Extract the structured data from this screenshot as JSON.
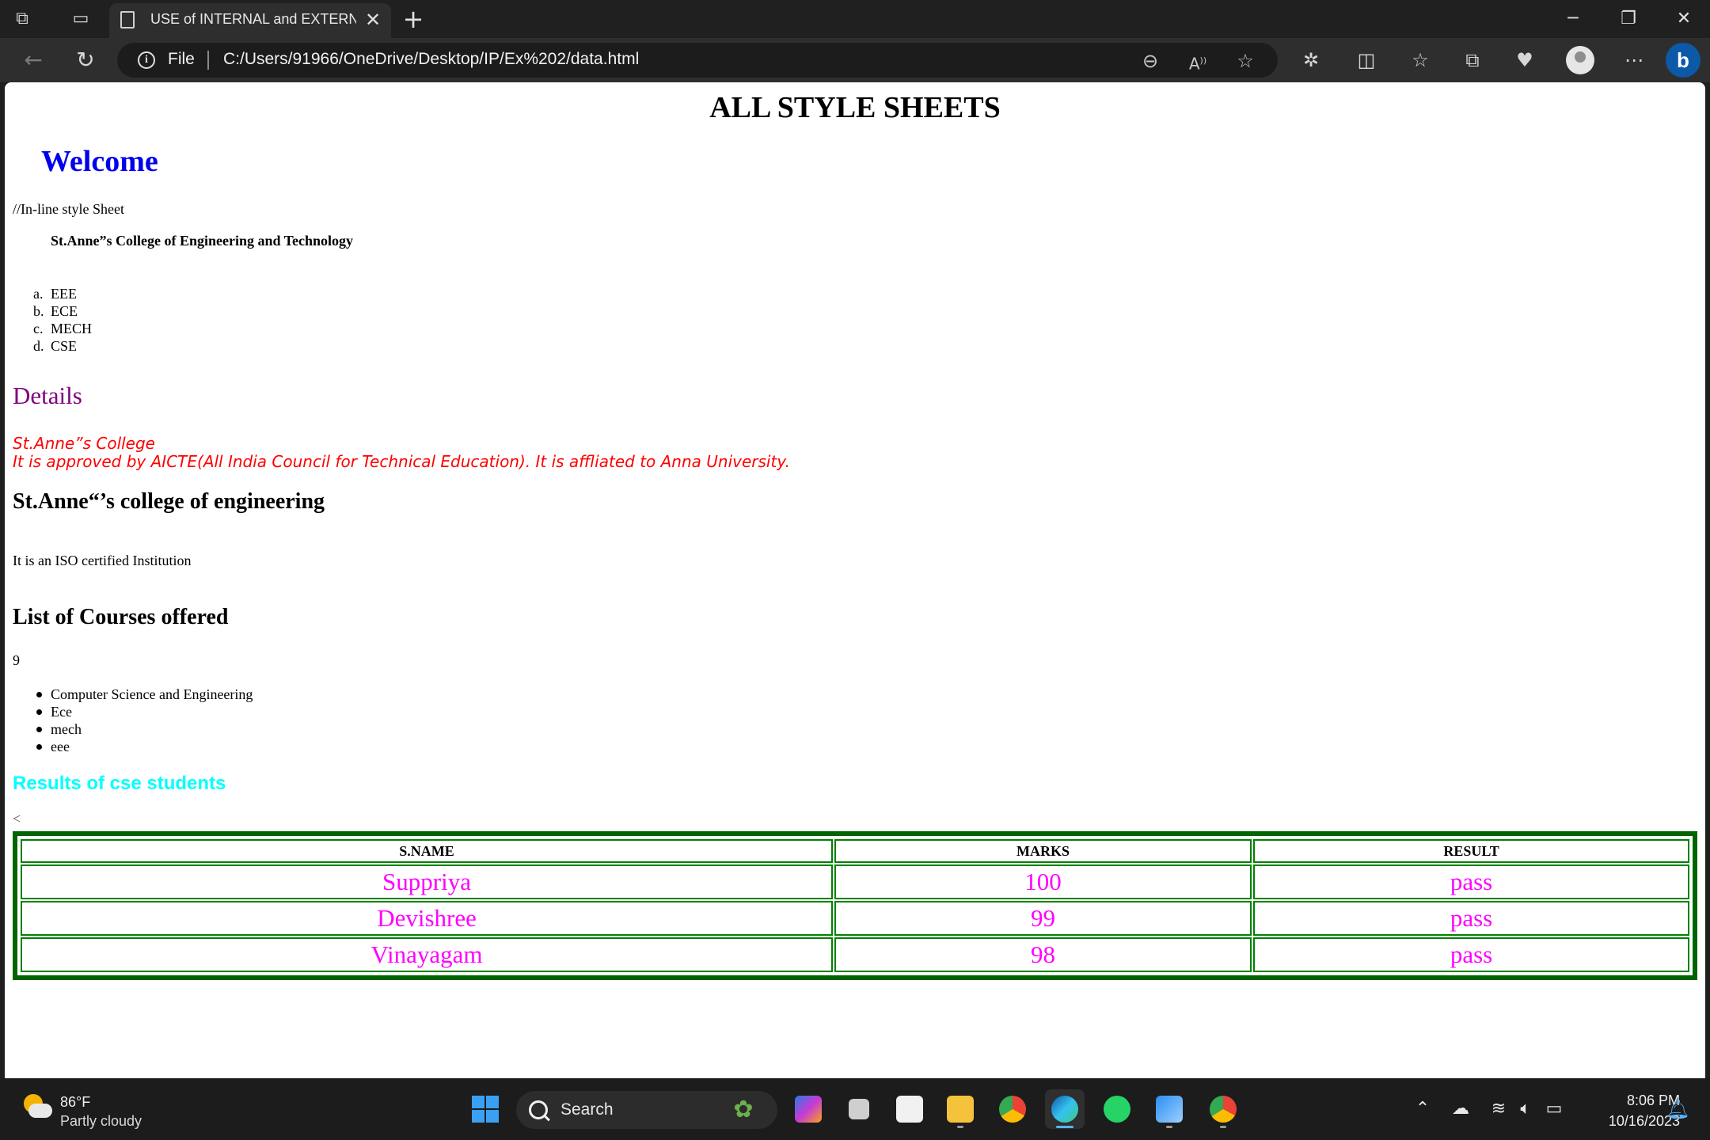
{
  "browser": {
    "tab_title": "USE of INTERNAL and EXTERNAL",
    "address_scheme_label": "File",
    "url": "C:/Users/91966/OneDrive/Desktop/IP/Ex%202/data.html"
  },
  "page": {
    "main_heading": "ALL STYLE SHEETS",
    "welcome": "Welcome",
    "inline_note": "//In-line style Sheet",
    "college_name": "St.Anne”s College of Engineering and Technology",
    "departments": [
      {
        "marker": "a.",
        "label": "EEE"
      },
      {
        "marker": "b.",
        "label": "ECE"
      },
      {
        "marker": "c.",
        "label": "MECH"
      },
      {
        "marker": "d.",
        "label": "CSE"
      }
    ],
    "details_heading": "Details",
    "details_line1": "St.Anne”s College",
    "details_line2": "It is approved by AICTE(All India Council for Technical Education). It is affliated to Anna University.",
    "sub_heading": "St.Anne“’s college of engineering",
    "iso_text": "It is an ISO certified Institution",
    "courses_heading": "List of Courses offered",
    "courses_count": "9",
    "courses": [
      "Computer Science and Engineering",
      "Ece",
      "mech",
      "eee"
    ],
    "results_heading": "Results of cse students",
    "stray_char": "<",
    "table": {
      "headers": [
        "S.NAME",
        "MARKS",
        "RESULT"
      ],
      "rows": [
        [
          "Suppriya",
          "100",
          "pass"
        ],
        [
          "Devishree",
          "99",
          "pass"
        ],
        [
          "Vinayagam",
          "98",
          "pass"
        ]
      ]
    }
  },
  "taskbar": {
    "temperature": "86°F",
    "condition": "Partly cloudy",
    "search_label": "Search",
    "time": "8:06 PM",
    "date": "10/16/2023"
  },
  "colors": {
    "welcome": "#0000ee",
    "details": "#800080",
    "italic_text": "#ff0000",
    "results": "#00ffff",
    "table_border": "#006400",
    "table_cells": "#ff00ff"
  }
}
